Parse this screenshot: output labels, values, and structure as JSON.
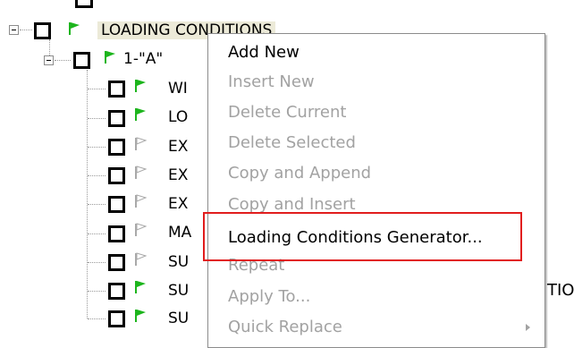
{
  "tree": {
    "root": {
      "label": "LOADING CONDITIONS"
    },
    "child": {
      "label": "1-\"A\""
    },
    "items": [
      {
        "label": "WI",
        "flag": "green-flag-icon"
      },
      {
        "label": "LO",
        "flag": "green-flag-icon"
      },
      {
        "label": "EX",
        "flag": "gray-flag-icon"
      },
      {
        "label": "EX",
        "flag": "gray-flag-icon"
      },
      {
        "label": "EX",
        "flag": "gray-flag-icon"
      },
      {
        "label": "MA",
        "flag": "gray-flag-icon"
      },
      {
        "label": "SU",
        "flag": "gray-flag-icon"
      },
      {
        "label": "SU",
        "flag": "green-flag-icon"
      },
      {
        "label": "SU",
        "flag": "green-flag-icon"
      }
    ],
    "right_text_fragments": [
      "TIO"
    ]
  },
  "context_menu": {
    "items": [
      {
        "label": "Add New",
        "enabled": true
      },
      {
        "label": "Insert New",
        "enabled": false
      },
      {
        "label": "Delete Current",
        "enabled": false
      },
      {
        "label": "Delete Selected",
        "enabled": false
      },
      {
        "label": "Copy and Append",
        "enabled": false
      },
      {
        "label": "Copy and Insert",
        "enabled": false
      },
      {
        "label": "Loading Conditions Generator...",
        "enabled": true
      },
      {
        "label": "Repeat",
        "enabled": false
      },
      {
        "label": "Apply To...",
        "enabled": false
      },
      {
        "label": "Quick Replace",
        "enabled": false
      }
    ]
  },
  "colors": {
    "green_flag": "#1db51d",
    "gray_flag": "#a9a9a9",
    "highlight": "#e11d1d",
    "selection_bg": "#ecead8"
  }
}
